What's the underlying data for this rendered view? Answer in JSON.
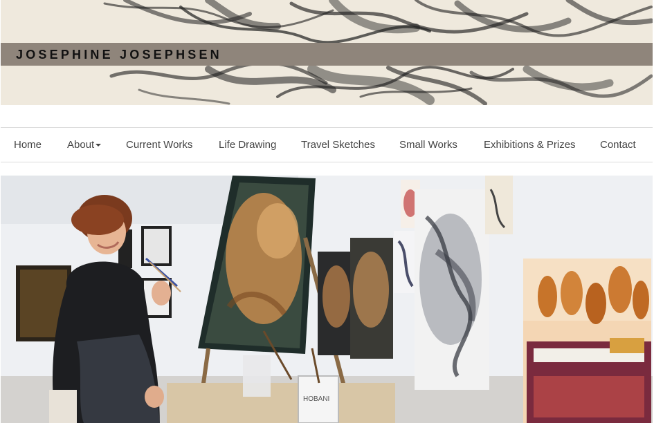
{
  "site": {
    "title": "JOSEPHINE JOSEPHSEN"
  },
  "nav": {
    "items": [
      {
        "label": "Home"
      },
      {
        "label": "About"
      },
      {
        "label": "Current Works"
      },
      {
        "label": "Life Drawing"
      },
      {
        "label": "Travel Sketches"
      },
      {
        "label": "Small Works"
      },
      {
        "label": "Exhibitions & Prizes"
      },
      {
        "label": "Contact"
      }
    ]
  },
  "hero": {
    "bucket_label": "HOBANI"
  },
  "colors": {
    "title_band": "#8f857b",
    "nav_text": "#444444",
    "banner_bg": "#efe9dd"
  }
}
